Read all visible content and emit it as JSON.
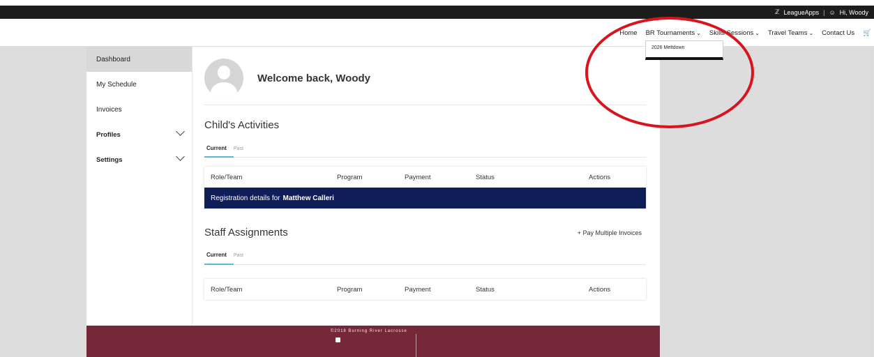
{
  "topbar": {
    "brand": "LeagueApps",
    "separator": "|",
    "greeting": "Hi, Woody"
  },
  "nav": {
    "items": [
      {
        "label": "Home",
        "has_dropdown": false
      },
      {
        "label": "BR Tournaments",
        "has_dropdown": true
      },
      {
        "label": "Skills Sessions",
        "has_dropdown": true
      },
      {
        "label": "Travel Teams",
        "has_dropdown": true
      },
      {
        "label": "Contact Us",
        "has_dropdown": false
      }
    ],
    "cart_icon": "cart-icon",
    "dropdown": {
      "items": [
        "2026 Meltdown"
      ]
    }
  },
  "sidebar": {
    "items": [
      {
        "label": "Dashboard",
        "active": true
      },
      {
        "label": "My Schedule"
      },
      {
        "label": "Invoices"
      },
      {
        "label": "Profiles",
        "expandable": true
      },
      {
        "label": "Settings",
        "expandable": true
      }
    ]
  },
  "main": {
    "welcome": "Welcome back, Woody",
    "child_activities": {
      "title": "Child's Activities",
      "tabs": [
        "Current",
        "Past"
      ],
      "columns": [
        "Role/Team",
        "Program",
        "Payment",
        "Status",
        "Actions"
      ],
      "registration_prefix": "Registration details for",
      "registration_name": "Matthew Calleri"
    },
    "staff": {
      "title": "Staff Assignments",
      "pay_multiple": "+ Pay Multiple Invoices",
      "tabs": [
        "Current",
        "Past"
      ],
      "columns": [
        "Role/Team",
        "Program",
        "Payment",
        "Status",
        "Actions"
      ]
    }
  },
  "footer": {
    "copyright": "©2018 Burning River Lacrosse"
  },
  "annotation": {
    "color": "#d8141e"
  },
  "colors": {
    "accent": "#5ab8d8",
    "registration_row": "#0f1d59",
    "footer": "#76283a"
  }
}
